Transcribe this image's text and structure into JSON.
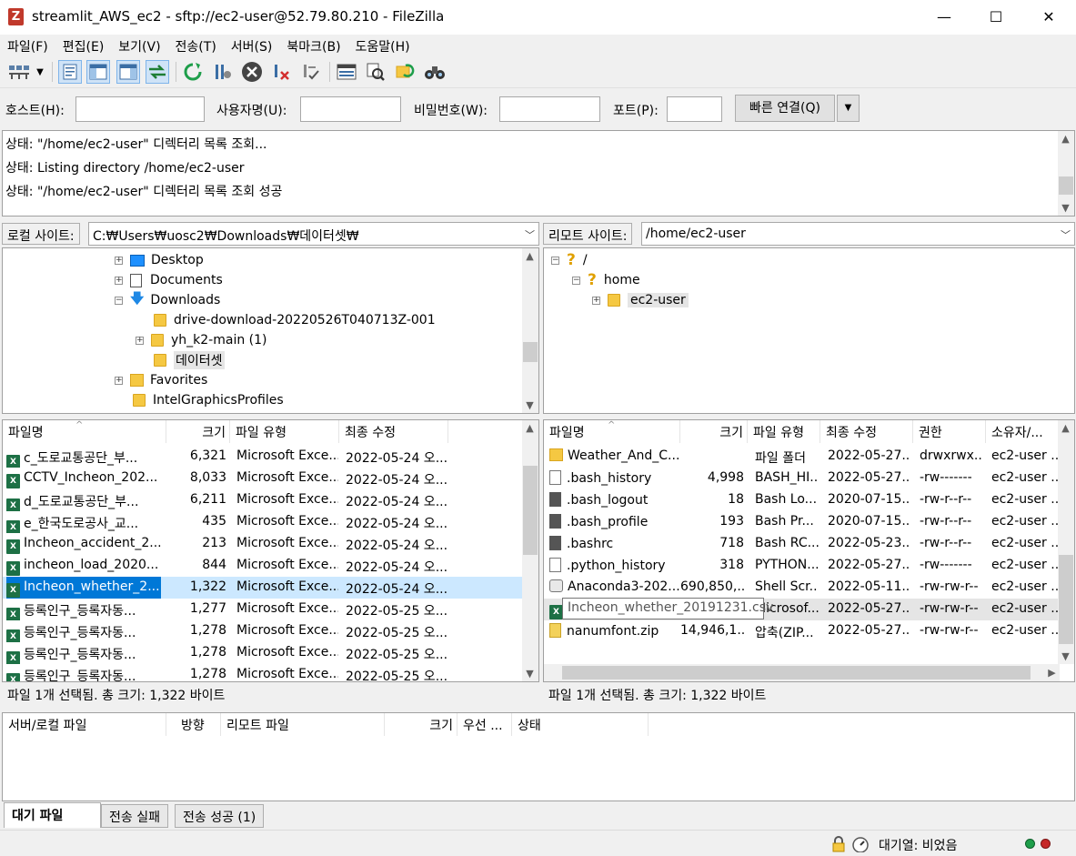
{
  "window": {
    "title": "streamlit_AWS_ec2 - sftp://ec2-user@52.79.80.210 - FileZilla",
    "app_icon": "Z",
    "minimize": "—",
    "maximize": "☐",
    "close": "✕"
  },
  "menu": [
    "파일(F)",
    "편집(E)",
    "보기(V)",
    "전송(T)",
    "서버(S)",
    "북마크(B)",
    "도움말(H)"
  ],
  "quickconnect": {
    "host_label": "호스트(H):",
    "user_label": "사용자명(U):",
    "pass_label": "비밀번호(W):",
    "port_label": "포트(P):",
    "host_value": "",
    "user_value": "",
    "pass_value": "",
    "port_value": "",
    "connect_label": "빠른 연결(Q)"
  },
  "log": [
    {
      "prefix": "상태:",
      "text": "\"/home/ec2-user\" 디렉터리 목록 조회..."
    },
    {
      "prefix": "상태:",
      "text": "Listing directory /home/ec2-user"
    },
    {
      "prefix": "상태:",
      "text": "\"/home/ec2-user\" 디렉터리 목록 조회 성공"
    }
  ],
  "local": {
    "site_label": "로컬 사이트:",
    "path": "C:₩Users₩uosc2₩Downloads₩데이터셋₩",
    "tree": [
      "Desktop",
      "Documents",
      "Downloads",
      "drive-download-20220526T040713Z-001",
      "yh_k2-main (1)",
      "데이터셋",
      "Favorites",
      "IntelGraphicsProfiles"
    ],
    "headers": [
      "파일명",
      "크기",
      "파일 유형",
      "최종 수정"
    ],
    "files": [
      {
        "name": "c_도로교통공단_부...",
        "size": "6,321",
        "type": "Microsoft Exce...",
        "modified": "2022-05-24 오..."
      },
      {
        "name": "CCTV_Incheon_202...",
        "size": "8,033",
        "type": "Microsoft Exce...",
        "modified": "2022-05-24 오..."
      },
      {
        "name": "d_도로교통공단_부...",
        "size": "6,211",
        "type": "Microsoft Exce...",
        "modified": "2022-05-24 오..."
      },
      {
        "name": "e_한국도로공사_교...",
        "size": "435",
        "type": "Microsoft Exce...",
        "modified": "2022-05-24 오..."
      },
      {
        "name": "Incheon_accident_2...",
        "size": "213",
        "type": "Microsoft Exce...",
        "modified": "2022-05-24 오..."
      },
      {
        "name": "incheon_load_2020...",
        "size": "844",
        "type": "Microsoft Exce...",
        "modified": "2022-05-24 오..."
      },
      {
        "name": "Incheon_whether_2...",
        "size": "1,322",
        "type": "Microsoft Exce...",
        "modified": "2022-05-24 오..."
      },
      {
        "name": "등록인구_등록자동...",
        "size": "1,277",
        "type": "Microsoft Exce...",
        "modified": "2022-05-25 오..."
      },
      {
        "name": "등록인구_등록자동...",
        "size": "1,278",
        "type": "Microsoft Exce...",
        "modified": "2022-05-25 오..."
      },
      {
        "name": "등록인구_등록자동...",
        "size": "1,278",
        "type": "Microsoft Exce...",
        "modified": "2022-05-25 오..."
      },
      {
        "name": "등록인구_등록자동...",
        "size": "1,278",
        "type": "Microsoft Exce...",
        "modified": "2022-05-25 오..."
      }
    ],
    "status": "파일 1개 선택됨. 총 크기: 1,322 바이트"
  },
  "remote": {
    "site_label": "리모트 사이트:",
    "path": "/home/ec2-user",
    "tree": [
      "/",
      "home",
      "ec2-user"
    ],
    "headers": [
      "파일명",
      "크기",
      "파일 유형",
      "최종 수정",
      "권한",
      "소유자/..."
    ],
    "files": [
      {
        "name": "Weather_And_C...",
        "size": "",
        "type": "파일 폴더",
        "modified": "2022-05-27...",
        "perm": "drwxrwx...",
        "owner": "ec2-user ..."
      },
      {
        "name": ".bash_history",
        "size": "4,998",
        "type": "BASH_HI...",
        "modified": "2022-05-27...",
        "perm": "-rw-------",
        "owner": "ec2-user ..."
      },
      {
        "name": ".bash_logout",
        "size": "18",
        "type": "Bash Lo...",
        "modified": "2020-07-15...",
        "perm": "-rw-r--r--",
        "owner": "ec2-user ..."
      },
      {
        "name": ".bash_profile",
        "size": "193",
        "type": "Bash Pr...",
        "modified": "2020-07-15...",
        "perm": "-rw-r--r--",
        "owner": "ec2-user ..."
      },
      {
        "name": ".bashrc",
        "size": "718",
        "type": "Bash RC...",
        "modified": "2022-05-23...",
        "perm": "-rw-r--r--",
        "owner": "ec2-user ..."
      },
      {
        "name": ".python_history",
        "size": "318",
        "type": "PYTHON...",
        "modified": "2022-05-27...",
        "perm": "-rw-------",
        "owner": "ec2-user ..."
      },
      {
        "name": "Anaconda3-202...",
        "size": "690,850,...",
        "type": "Shell Scr...",
        "modified": "2022-05-11...",
        "perm": "-rw-rw-r--",
        "owner": "ec2-user ..."
      },
      {
        "name": "Incheon_whether_20191231.csv",
        "size": "",
        "type": "Microsof...",
        "modified": "2022-05-27...",
        "perm": "-rw-rw-r--",
        "owner": "ec2-user ..."
      },
      {
        "name": "nanumfont.zip",
        "size": "14,946,1...",
        "type": "압축(ZIP...",
        "modified": "2022-05-27...",
        "perm": "-rw-rw-r--",
        "owner": "ec2-user ..."
      }
    ],
    "tooltip": "Incheon_whether_20191231.csv",
    "status": "파일 1개 선택됨. 총 크기: 1,322 바이트"
  },
  "queue": {
    "headers": [
      "서버/로컬 파일",
      "방향",
      "리모트 파일",
      "크기",
      "우선 ...",
      "상태"
    ],
    "tabs": [
      "대기 파일",
      "전송 실패",
      "전송 성공 (1)"
    ]
  },
  "statusbar": {
    "queue_text": "대기열: 비었음"
  }
}
